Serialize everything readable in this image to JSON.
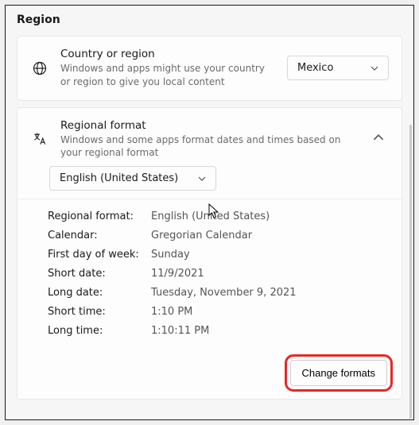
{
  "page": {
    "title": "Region"
  },
  "country_card": {
    "title": "Country or region",
    "subtitle": "Windows and apps might use your country or region to give you local content",
    "selected": "Mexico"
  },
  "regional_card": {
    "title": "Regional format",
    "subtitle": "Windows and some apps format dates and times based on your regional format",
    "dropdown_value": "English (United States)"
  },
  "details": {
    "regional_format_label": "Regional format:",
    "regional_format_value": "English (United States)",
    "calendar_label": "Calendar:",
    "calendar_value": "Gregorian Calendar",
    "first_day_label": "First day of week:",
    "first_day_value": "Sunday",
    "short_date_label": "Short date:",
    "short_date_value": "11/9/2021",
    "long_date_label": "Long date:",
    "long_date_value": "Tuesday, November 9, 2021",
    "short_time_label": "Short time:",
    "short_time_value": "1:10 PM",
    "long_time_label": "Long time:",
    "long_time_value": "1:10:11 PM"
  },
  "actions": {
    "change_formats": "Change formats"
  }
}
